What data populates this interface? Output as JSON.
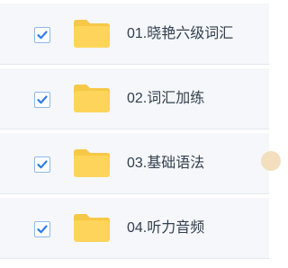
{
  "files": [
    {
      "name": "01.晓艳六级词汇",
      "checked": true,
      "icon": "folder-icon"
    },
    {
      "name": "02.词汇加练",
      "checked": true,
      "icon": "folder-icon"
    },
    {
      "name": "03.基础语法",
      "checked": true,
      "icon": "folder-icon"
    },
    {
      "name": "04.听力音频",
      "checked": true,
      "icon": "folder-icon"
    }
  ],
  "colors": {
    "row_background": "#f5f7fa",
    "checkmark": "#2f7be8",
    "folder": "#ffd45a",
    "folder_tab": "#f7c847",
    "text": "#333f4e"
  }
}
